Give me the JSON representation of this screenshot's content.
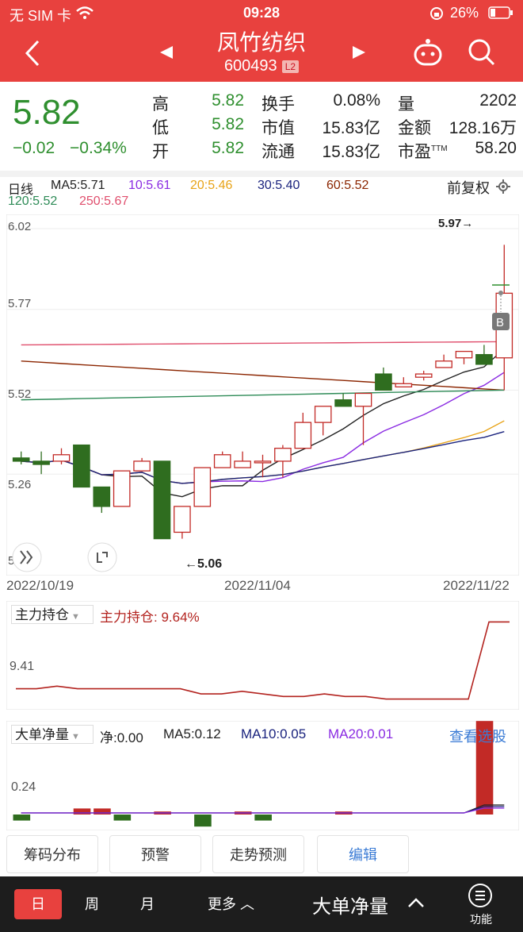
{
  "status": {
    "carrier": "无 SIM 卡",
    "time": "09:28",
    "battery": "26%"
  },
  "header": {
    "title": "凤竹纺织",
    "code": "600493",
    "badge": "L2"
  },
  "quote": {
    "price": "5.82",
    "change": "−0.02",
    "change_pct": "−0.34%",
    "rows": [
      [
        {
          "k": "高",
          "v": "5.82"
        },
        {
          "k": "换手",
          "v": "0.08%"
        },
        {
          "k": "量",
          "v": "2202"
        }
      ],
      [
        {
          "k": "低",
          "v": "5.82"
        },
        {
          "k": "市值",
          "v": "15.83亿"
        },
        {
          "k": "金额",
          "v": "128.16万"
        }
      ],
      [
        {
          "k": "开",
          "v": "5.82"
        },
        {
          "k": "流通",
          "v": "15.83亿"
        },
        {
          "k": "市盈",
          "v": "58.20",
          "sup": "TTM"
        }
      ]
    ]
  },
  "kline": {
    "period": "日线",
    "adjust": "前复权",
    "ma": [
      {
        "label": "MA5:5.71",
        "color": "#222222"
      },
      {
        "label": "10:5.61",
        "color": "#8a2be2"
      },
      {
        "label": "20:5.46",
        "color": "#e8a317"
      },
      {
        "label": "30:5.40",
        "color": "#1a237e"
      },
      {
        "label": "60:5.52",
        "color": "#8b2500"
      },
      {
        "label": "120:5.52",
        "color": "#2e8b57"
      },
      {
        "label": "250:5.67",
        "color": "#e0506e"
      }
    ],
    "y_ticks": [
      "6.02",
      "5.77",
      "5.52",
      "5.26",
      "5.0"
    ],
    "high_label": "5.97→",
    "low_label": "←5.06",
    "dates": [
      "2022/10/19",
      "2022/11/04",
      "2022/11/22"
    ],
    "marker": "B"
  },
  "chart_data": [
    {
      "type": "candlestick",
      "title": "日线",
      "x": [
        "2022/10/19",
        "",
        "",
        "",
        "",
        "",
        "",
        "",
        "",
        "",
        "",
        "2022/11/04",
        "",
        "",
        "",
        "",
        "",
        "",
        "",
        "",
        "",
        "",
        "",
        "2022/11/22"
      ],
      "ohlc": [
        [
          5.31,
          5.33,
          5.29,
          5.3
        ],
        [
          5.3,
          5.33,
          5.26,
          5.29
        ],
        [
          5.3,
          5.34,
          5.29,
          5.32
        ],
        [
          5.35,
          5.35,
          5.22,
          5.22
        ],
        [
          5.22,
          5.22,
          5.14,
          5.16
        ],
        [
          5.16,
          5.27,
          5.16,
          5.27
        ],
        [
          5.27,
          5.31,
          5.27,
          5.3
        ],
        [
          5.3,
          5.3,
          5.06,
          5.06
        ],
        [
          5.08,
          5.16,
          5.06,
          5.16
        ],
        [
          5.16,
          5.28,
          5.16,
          5.28
        ],
        [
          5.28,
          5.33,
          5.28,
          5.32
        ],
        [
          5.28,
          5.33,
          5.28,
          5.3
        ],
        [
          5.3,
          5.32,
          5.25,
          5.3
        ],
        [
          5.3,
          5.35,
          5.25,
          5.34
        ],
        [
          5.34,
          5.45,
          5.34,
          5.42
        ],
        [
          5.42,
          5.47,
          5.38,
          5.47
        ],
        [
          5.49,
          5.51,
          5.47,
          5.47
        ],
        [
          5.47,
          5.5,
          5.35,
          5.51
        ],
        [
          5.57,
          5.59,
          5.52,
          5.52
        ],
        [
          5.53,
          5.56,
          5.53,
          5.54
        ],
        [
          5.56,
          5.58,
          5.55,
          5.57
        ],
        [
          5.59,
          5.63,
          5.59,
          5.61
        ],
        [
          5.62,
          5.63,
          5.6,
          5.64
        ],
        [
          5.63,
          5.66,
          5.6,
          5.6
        ],
        [
          5.62,
          5.97,
          5.52,
          5.82
        ]
      ],
      "ylim": [
        5.0,
        6.02
      ]
    },
    {
      "type": "line",
      "title": "主力持仓",
      "series": [
        {
          "name": "主力持仓",
          "values": [
            9.38,
            9.38,
            9.39,
            9.38,
            9.38,
            9.38,
            9.38,
            9.38,
            9.38,
            9.36,
            9.36,
            9.37,
            9.36,
            9.35,
            9.35,
            9.36,
            9.35,
            9.35,
            9.34,
            9.34,
            9.34,
            9.34,
            9.34,
            9.64,
            9.64
          ]
        }
      ],
      "y_ticks": [
        "9.41"
      ]
    },
    {
      "type": "bar",
      "title": "大单净量",
      "values": [
        -0.02,
        0,
        0,
        0.02,
        0.02,
        -0.02,
        0,
        0.01,
        0,
        -0.04,
        0,
        0.01,
        -0.02,
        0,
        0,
        0,
        0.01,
        0,
        0,
        0,
        0,
        0,
        0,
        0.31,
        0
      ],
      "y_ticks": [
        "0.24"
      ]
    }
  ],
  "holding": {
    "dropdown": "主力持仓",
    "label": "主力持仓: 9.64%",
    "tick": "9.41"
  },
  "netflow": {
    "dropdown": "大单净量",
    "stats": [
      "净:0.00",
      "MA5:0.12",
      "MA10:0.05",
      "MA20:0.01"
    ],
    "link": "查看选股",
    "tick": "0.24"
  },
  "buttons": [
    "筹码分布",
    "预警",
    "走势预测",
    "编辑"
  ],
  "bottom": {
    "tabs": [
      "日",
      "周",
      "月",
      "更多"
    ],
    "indicator": "大单净量",
    "func": "功能"
  },
  "colors": {
    "accent": "#e8413e",
    "down": "#2f8f2f"
  }
}
